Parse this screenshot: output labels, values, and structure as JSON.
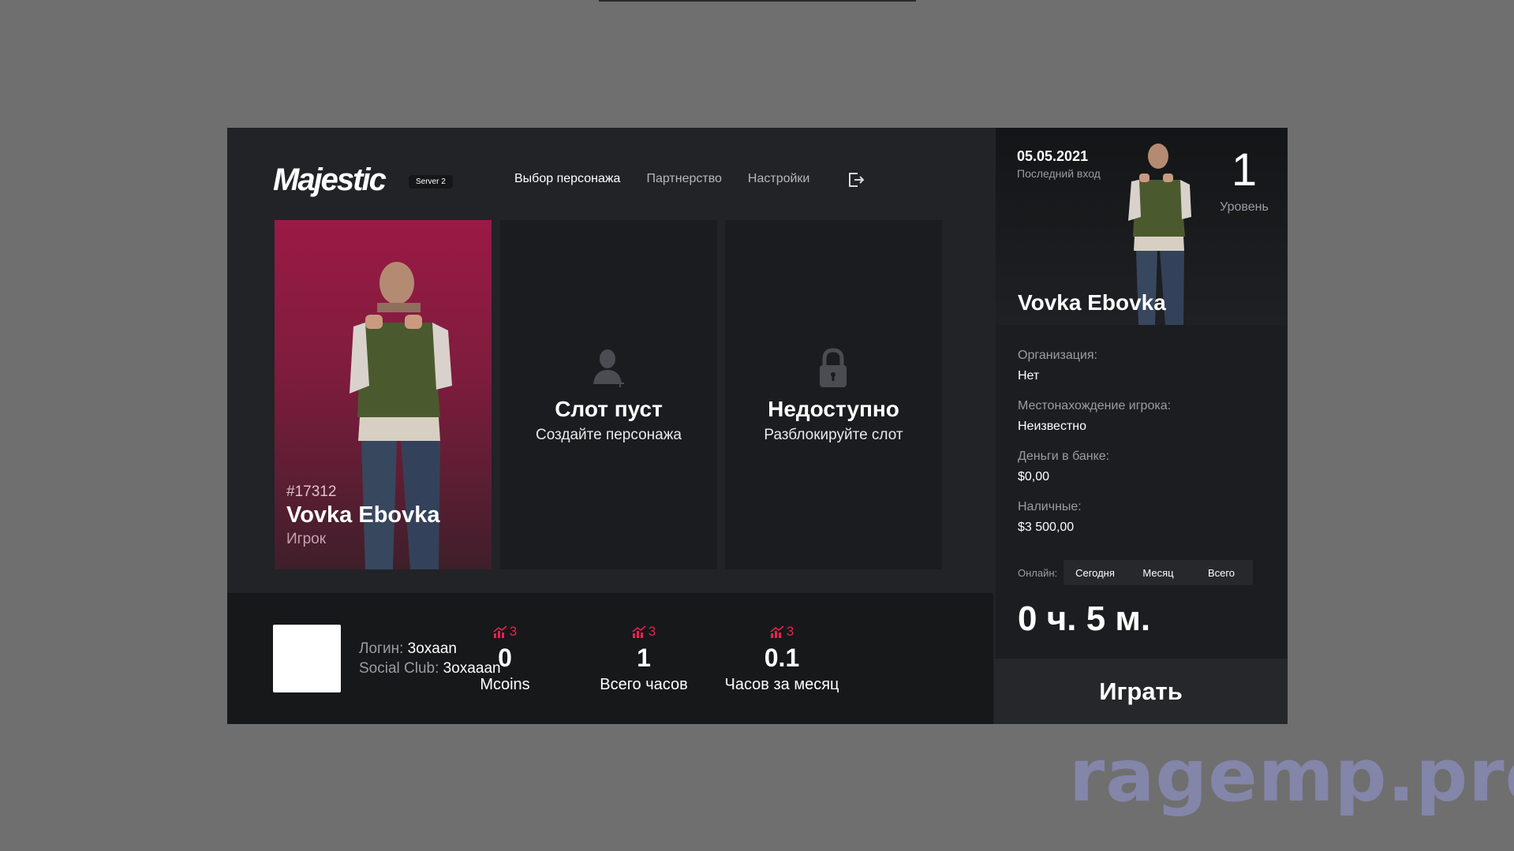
{
  "header": {
    "logo": "Majestic",
    "server": "Server 2",
    "nav": [
      {
        "label": "Выбор персонажа"
      },
      {
        "label": "Партнерство"
      },
      {
        "label": "Настройки"
      }
    ]
  },
  "slots": {
    "character": {
      "id": "#17312",
      "name": "Vovka Ebovka",
      "role": "Игрок"
    },
    "empty": {
      "title": "Слот пуст",
      "subtitle": "Создайте персонажа"
    },
    "locked": {
      "title": "Недоступно",
      "subtitle": "Разблокируйте слот"
    }
  },
  "account": {
    "login_label": "Логин:",
    "login_value": "3oxaan",
    "social_label": "Social Club:",
    "social_value": "3oxaaan"
  },
  "stats": [
    {
      "trend": "3",
      "value": "0",
      "label": "Mcoins"
    },
    {
      "trend": "3",
      "value": "1",
      "label": "Всего часов"
    },
    {
      "trend": "3",
      "value": "0.1",
      "label": "Часов за месяц"
    }
  ],
  "profile": {
    "last_login_date": "05.05.2021",
    "last_login_label": "Последний вход",
    "level": "1",
    "level_label": "Уровень",
    "name": "Vovka Ebovka",
    "info": [
      {
        "label": "Организация:",
        "value": "Нет"
      },
      {
        "label": "Местонахождение игрока:",
        "value": "Неизвестно"
      },
      {
        "label": "Деньги в банке:",
        "value": "$0,00"
      },
      {
        "label": "Наличные:",
        "value": "$3 500,00"
      }
    ],
    "online_label": "Онлайн:",
    "online_tabs": [
      "Сегодня",
      "Месяц",
      "Всего"
    ],
    "online_time": "0 ч. 5 м.",
    "play_label": "Играть"
  },
  "watermark": "ragemp.pro",
  "colors": {
    "accent": "#e8214e",
    "panel": "#212326",
    "slot_active": "#9a1a45"
  }
}
